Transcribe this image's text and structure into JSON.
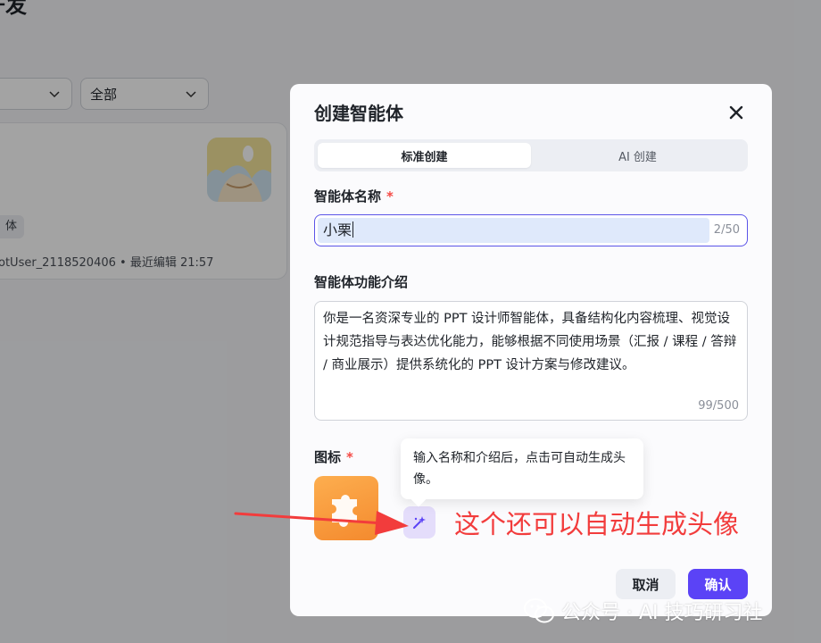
{
  "background": {
    "page_title": "开发",
    "filter_select_1": "",
    "filter_select_2": "全部",
    "card_tag": "体",
    "card_meta": "otUser_2118520406 • 最近编辑 21:57"
  },
  "modal": {
    "title": "创建智能体",
    "tabs": [
      {
        "label": "标准创建",
        "active": true
      },
      {
        "label": "AI 创建",
        "active": false
      }
    ],
    "name_label": "智能体名称",
    "name_value": "小栗",
    "name_count": "2/50",
    "desc_label": "智能体功能介绍",
    "desc_value": "你是一名资深专业的 PPT 设计师智能体，具备结构化内容梳理、视觉设计规范指导与表达优化能力，能够根据不同使用场景（汇报 / 课程 / 答辩 / 商业展示）提供系统化的 PPT 设计方案与修改建议。",
    "desc_count": "99/500",
    "icon_label": "图标",
    "required_mark": "*",
    "tooltip": "输入名称和介绍后，点击可自动生成头像。",
    "cancel_label": "取消",
    "confirm_label": "确认"
  },
  "annotation": {
    "text": "这个还可以自动生成头像",
    "color": "#f23c3c"
  },
  "watermark": {
    "text": "公众号 · AI 技巧研习社"
  },
  "colors": {
    "accent": "#5b43f6",
    "input_focus": "#5b54e8",
    "required": "#f54a45",
    "icon_tile": "#f48a2e"
  },
  "icons": [
    "chevron-down-icon",
    "close-icon",
    "puzzle-icon",
    "sparkle-icon",
    "arrow-icon",
    "wechat-icon"
  ]
}
